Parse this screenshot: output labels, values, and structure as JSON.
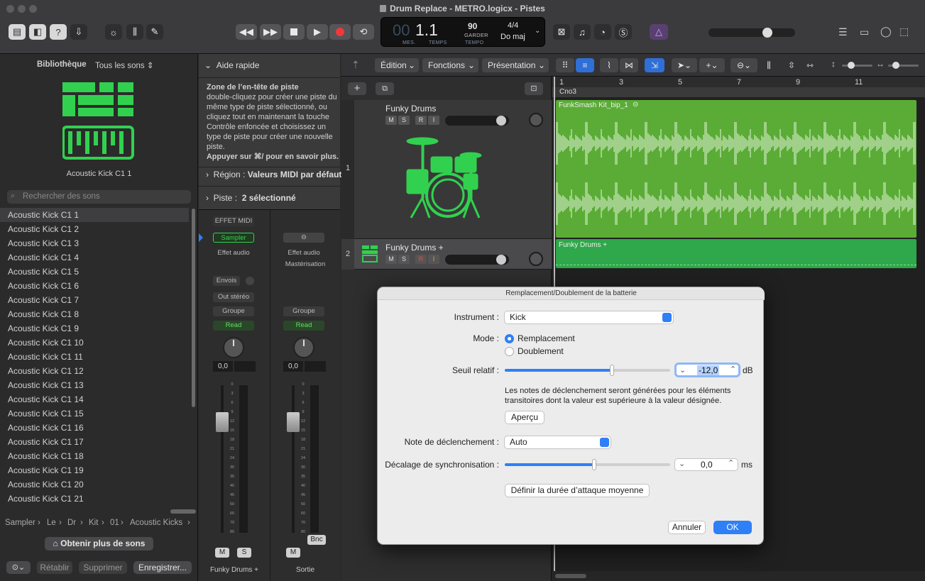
{
  "window": {
    "title": "Drum Replace - METRO.logicx - Pistes"
  },
  "lcd": {
    "bar": "1.1",
    "bar_label": "MES.",
    "beat_label": "TEMPS",
    "tempo": "90",
    "tempo_mode": "GARDER",
    "tempo_label": "TEMPO",
    "signature": "4/4",
    "key": "Do maj"
  },
  "library": {
    "tab": "Bibliothèque",
    "filter": "Tous les sons",
    "patch_name": "Acoustic Kick C1 1",
    "search_placeholder": "Rechercher des sons",
    "items": [
      "Acoustic Kick C1 1",
      "Acoustic Kick C1 2",
      "Acoustic Kick C1 3",
      "Acoustic Kick C1 4",
      "Acoustic Kick C1 5",
      "Acoustic Kick C1 6",
      "Acoustic Kick C1 7",
      "Acoustic Kick C1 8",
      "Acoustic Kick C1 9",
      "Acoustic Kick C1 10",
      "Acoustic Kick C1 11",
      "Acoustic Kick C1 12",
      "Acoustic Kick C1 13",
      "Acoustic Kick C1 14",
      "Acoustic Kick C1 15",
      "Acoustic Kick C1 16",
      "Acoustic Kick C1 17",
      "Acoustic Kick C1 18",
      "Acoustic Kick C1 19",
      "Acoustic Kick C1 20",
      "Acoustic Kick C1 21"
    ],
    "path": [
      "Sampler",
      "Le",
      "Dr",
      "Kit",
      "01",
      "Acoustic Kicks"
    ],
    "more_sounds": "Obtenir plus de sons",
    "restore": "Rétablir",
    "delete": "Supprimer",
    "save": "Enregistrer..."
  },
  "quickhelp": {
    "title": "Aide rapide",
    "heading": "Zone de l’en-tête de piste",
    "body": "double-cliquez pour créer une piste du même type de piste sélectionné, ou cliquez tout en maintenant la touche Contrôle enfoncée et choisissez un type de piste pour créer une nouvelle piste.",
    "more": "Appuyer sur ⌘/ pour en savoir plus.",
    "region_label": "Région",
    "region_value": "Valeurs MIDI par défaut",
    "track_label": "Piste",
    "track_value": "2 sélectionné"
  },
  "mixer": {
    "strip1": {
      "midi_fx": "EFFET MIDI",
      "instrument": "Sampler",
      "audio_fx": "Effet audio",
      "sends": "Envois",
      "output": "Out stéréo",
      "group": "Groupe",
      "automation": "Read",
      "pan_value": "0,0",
      "mute": "M",
      "solo": "S",
      "name": "Funky Drums +"
    },
    "strip2": {
      "audio_fx": "Effet audio",
      "mastering": "Mastérisation",
      "group": "Groupe",
      "automation": "Read",
      "pan_value": "0,0",
      "mute": "M",
      "bounce": "Bnc",
      "name": "Sortie"
    },
    "scale": [
      "0",
      "3",
      "6",
      "9",
      "12",
      "15",
      "18",
      "21",
      "24",
      "30",
      "35",
      "40",
      "45",
      "50",
      "60",
      "70",
      "80"
    ]
  },
  "tracks_toolbar": {
    "edit": "Édition",
    "functions": "Fonctions",
    "view": "Présentation"
  },
  "ruler": [
    "1",
    "3",
    "5",
    "7",
    "9",
    "11"
  ],
  "marker": "Cno3",
  "tracks": [
    {
      "number": "1",
      "name": "Funky Drums",
      "mute": "M",
      "solo": "S",
      "record": "R",
      "input": "I",
      "region": "FunkSmash Kit_bip_1"
    },
    {
      "number": "2",
      "name": "Funky Drums +",
      "mute": "M",
      "solo": "S",
      "record": "R",
      "input": "I",
      "region": "Funky Drums +"
    }
  ],
  "dialog": {
    "title": "Remplacement/Doublement de la batterie",
    "instrument_label": "Instrument :",
    "instrument_value": "Kick",
    "mode_label": "Mode :",
    "mode_replace": "Remplacement",
    "mode_double": "Doublement",
    "threshold_label": "Seuil relatif :",
    "threshold_value": "-12,0",
    "threshold_unit": "dB",
    "threshold_level": 0.9,
    "description": "Les notes de déclenchement seront générées pour les éléments transitoires dont la valeur est supérieure à la valeur désignée.",
    "preview": "Aperçu",
    "trigger_label": "Note de déclenchement :",
    "trigger_value": "Auto",
    "offset_label": "Décalage de synchronisation :",
    "offset_value": "0,0",
    "offset_unit": "ms",
    "offset_level": 0.75,
    "set_attack": "Définir la durée d’attaque moyenne",
    "cancel": "Annuler",
    "ok": "OK"
  },
  "colors": {
    "accent": "#2f7ff6",
    "region_green": "#5aac36",
    "midi_green": "#2ea84a",
    "icon_green": "#31d14f"
  }
}
